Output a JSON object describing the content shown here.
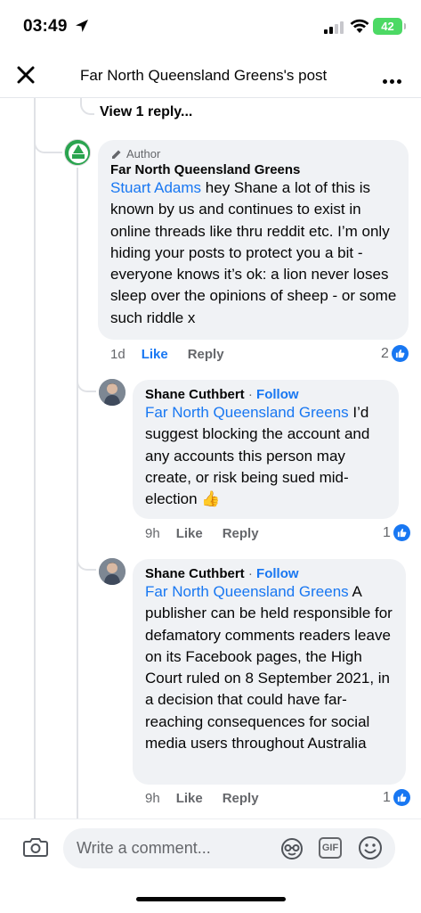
{
  "status_bar": {
    "time": "03:49",
    "battery": "42"
  },
  "header": {
    "title": "Far North Queensland Greens's post"
  },
  "thread": {
    "view_replies": "View 1 reply..."
  },
  "comments": [
    {
      "badge": "Author",
      "author": "Far North Queensland Greens",
      "mention": "Stuart Adams",
      "text": " hey Shane a lot of this is known by us and continues to exist in online threads like thru reddit etc. I’m only hiding your posts to protect you a bit - everyone knows it’s ok: a lion never loses sleep over the opinions of sheep - or some such riddle x",
      "age": "1d",
      "like": "Like",
      "reply": "Reply",
      "reactions": "2"
    },
    {
      "author": "Shane Cuthbert",
      "follow": "Follow",
      "mention": "Far North Queensland Greens",
      "text": " I’d suggest blocking the account and any accounts this person may create, or risk being sued mid-election ",
      "emoji": "👍",
      "age": "9h",
      "like": "Like",
      "reply": "Reply",
      "reactions": "1"
    },
    {
      "author": "Shane Cuthbert",
      "follow": "Follow",
      "mention": "Far North Queensland Greens",
      "text": " A publisher can be held responsible for defamatory comments readers leave on its Facebook pages, the High Court ruled on 8 September 2021, in a decision that could have far-reaching consequences for social media users throughout Australia",
      "age": "9h",
      "like": "Like",
      "reply": "Reply",
      "reactions": "1"
    }
  ],
  "composer": {
    "placeholder": "Write a comment...",
    "gif_label": "GIF"
  },
  "colors": {
    "link": "#1877f2",
    "bubble": "#f0f2f5",
    "muted": "#65676b"
  }
}
